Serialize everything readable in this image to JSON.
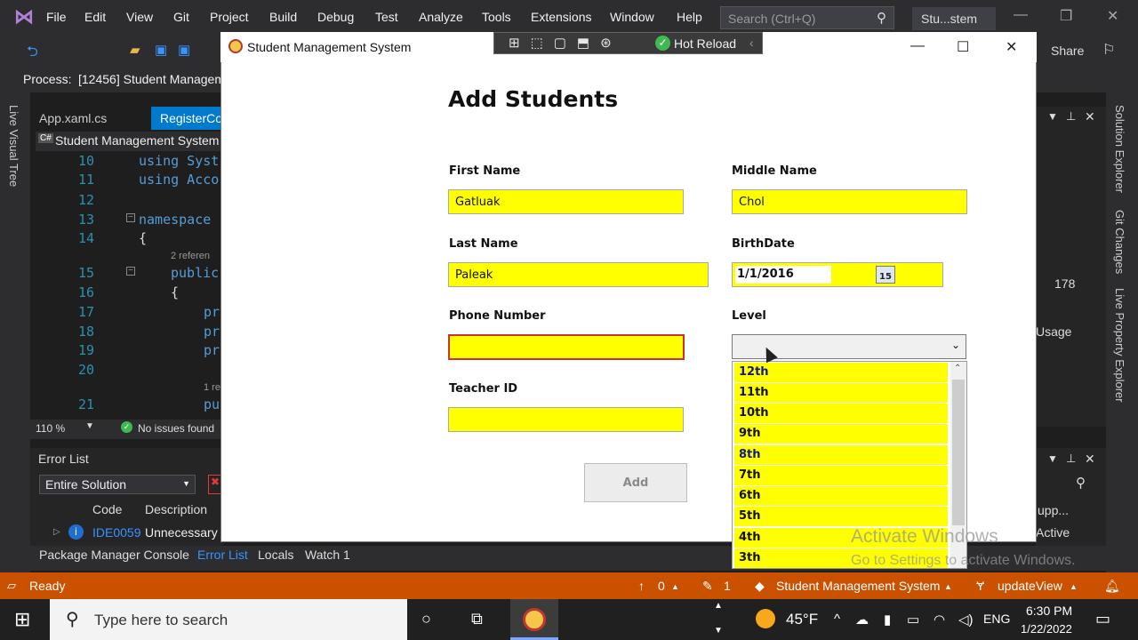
{
  "vs": {
    "menu": [
      "File",
      "Edit",
      "View",
      "Git",
      "Project",
      "Build",
      "Debug",
      "Test",
      "Analyze",
      "Tools",
      "Extensions",
      "Window",
      "Help"
    ],
    "search_placeholder": "Search (Ctrl+Q)",
    "solution_badge": "Stu...stem",
    "process_label": "Process:",
    "process_value": "[12456] Student Managem",
    "share_label": "Share",
    "tabs": [
      "App.xaml.cs",
      "RegisterCo"
    ],
    "nav_scope": "Student Management System",
    "code_lines": [
      {
        "n": "10",
        "text": "using Syst"
      },
      {
        "n": "11",
        "text": "using Acco"
      },
      {
        "n": "12",
        "text": ""
      },
      {
        "n": "13",
        "text": "namespace"
      },
      {
        "n": "14",
        "text": "{"
      },
      {
        "n": "15",
        "text": "public"
      },
      {
        "n": "16",
        "text": "{"
      },
      {
        "n": "17",
        "text": "pr"
      },
      {
        "n": "18",
        "text": "pr"
      },
      {
        "n": "19",
        "text": "pr"
      },
      {
        "n": "20",
        "text": ""
      },
      {
        "n": "21",
        "text": "pu"
      }
    ],
    "refs_2": "2 referen",
    "refs_1": "1 re",
    "zoom": "110 %",
    "issues": "No issues found",
    "error_list": {
      "title": "Error List",
      "scope": "Entire Solution",
      "col_code": "Code",
      "col_desc": "Description",
      "row_code": "IDE0059",
      "row_desc": "Unnecessary a"
    },
    "bottom_tabs": [
      "Package Manager Console",
      "Error List",
      "Locals",
      "Watch 1"
    ],
    "right_labels": [
      "Solution Explorer",
      "Git Changes",
      "Live Property Explorer"
    ],
    "right_value": "178",
    "right_usage": "Usage",
    "right_supp": "upp...",
    "right_active": "Active",
    "left_label": "Live Visual Tree",
    "status": {
      "ready": "Ready",
      "up_count": "0",
      "edit_count": "1",
      "repo": "Student Management System",
      "branch": "updateView"
    }
  },
  "app": {
    "title": "Student Management System",
    "hot_reload": "Hot Reload",
    "heading": "Add Students",
    "first_name_label": "First Name",
    "first_name_value": "Gatluak",
    "middle_name_label": "Middle Name",
    "middle_name_value": "Chol",
    "last_name_label": "Last Name",
    "last_name_value": "Paleak",
    "birthdate_label": "BirthDate",
    "birthdate_value": "1/1/2016",
    "calendar_day": "15",
    "phone_label": "Phone Number",
    "phone_value": "",
    "level_label": "Level",
    "level_value": "",
    "teacher_label": "Teacher ID",
    "teacher_value": "",
    "add_button": "Add",
    "level_options": [
      "12th",
      "11th",
      "10th",
      "9th",
      "8th",
      "7th",
      "6th",
      "5th",
      "4th",
      "3th"
    ]
  },
  "watermark": {
    "line1": "Activate Windows",
    "line2": "Go to Settings to activate Windows."
  },
  "taskbar": {
    "search_placeholder": "Type here to search",
    "weather": "45°F",
    "lang": "ENG",
    "time": "6:30 PM",
    "date": "1/22/2022"
  },
  "colors": {
    "field_yellow": "#ffff00",
    "status_orange": "#ca5100",
    "invalid_border": "#d03030"
  }
}
